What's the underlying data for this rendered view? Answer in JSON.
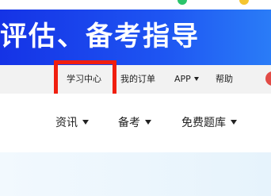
{
  "banner": {
    "title": "评估、备考指导"
  },
  "topnav": {
    "items": [
      {
        "label": "学习中心",
        "has_dropdown": false
      },
      {
        "label": "我的订单",
        "has_dropdown": false
      },
      {
        "label": "APP",
        "has_dropdown": true
      },
      {
        "label": "帮助",
        "has_dropdown": false
      }
    ]
  },
  "mainnav": {
    "items": [
      {
        "label": "资讯",
        "has_dropdown": true
      },
      {
        "label": "备考",
        "has_dropdown": true
      },
      {
        "label": "免费题库",
        "has_dropdown": true
      }
    ]
  },
  "colors": {
    "banner": "#1e55f2",
    "highlight": "#f01e0f",
    "topnav_bg": "#f2f2f2",
    "hero_bg": "#eaf5fd"
  },
  "icons": [
    "caret-down-icon",
    "avatar"
  ]
}
